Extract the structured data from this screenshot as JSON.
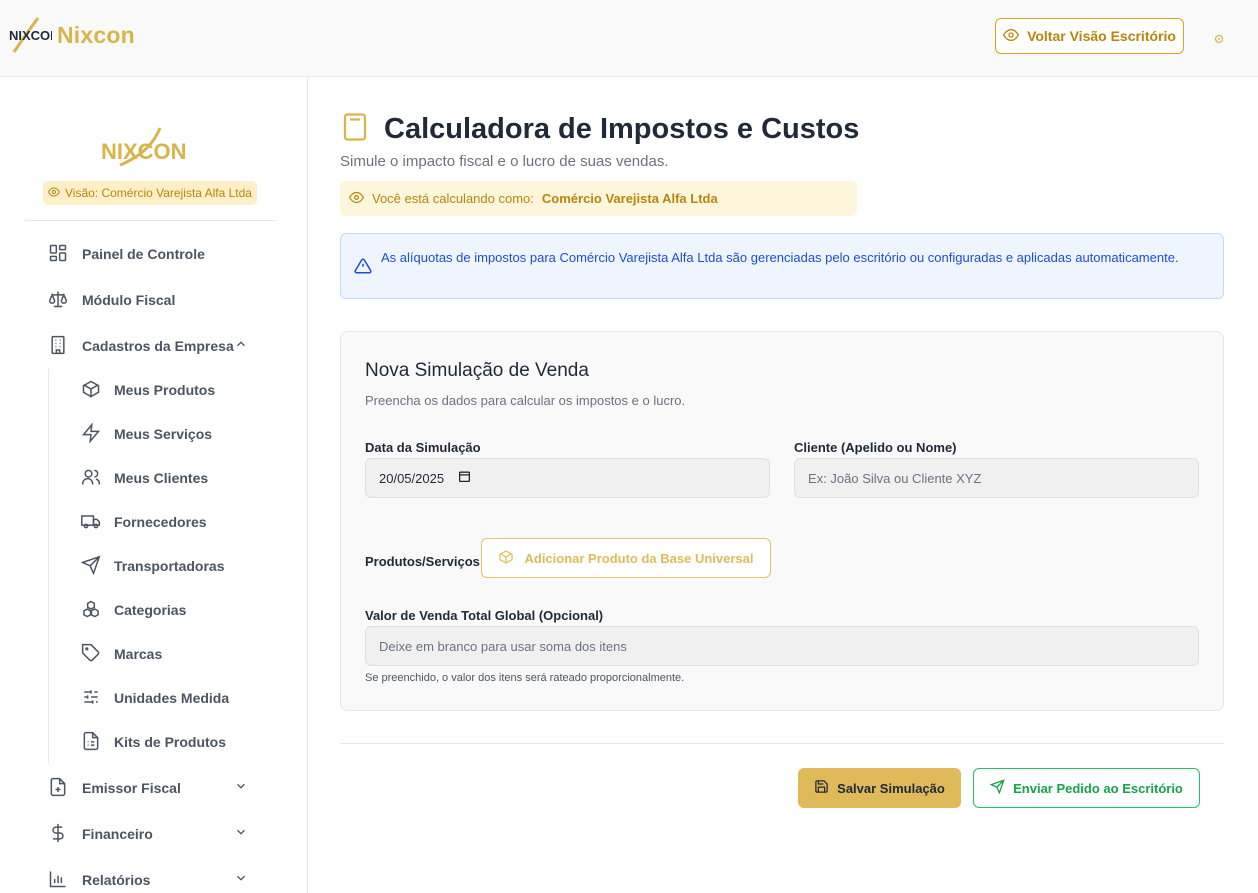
{
  "header": {
    "brand_name": "Nixcon",
    "logo_text": "NIXCON",
    "voltar_label": "Voltar Visão Escritório"
  },
  "sidebar": {
    "logo_text": "NIXCON",
    "visao_badge": "Visão: Comércio Varejista Alfa Ltda",
    "items": [
      {
        "label": "Painel de Controle",
        "icon": "dashboard-icon"
      },
      {
        "label": "Módulo Fiscal",
        "icon": "scale-icon"
      },
      {
        "label": "Cadastros da Empresa",
        "icon": "building-icon",
        "expanded": true
      },
      {
        "label": "Emissor Fiscal",
        "icon": "file-plus-icon"
      },
      {
        "label": "Financeiro",
        "icon": "dollar-icon"
      },
      {
        "label": "Relatórios",
        "icon": "bar-chart-icon"
      }
    ],
    "subitems": [
      {
        "label": "Meus Produtos",
        "icon": "box-icon"
      },
      {
        "label": "Meus Serviços",
        "icon": "zap-icon"
      },
      {
        "label": "Meus Clientes",
        "icon": "users-icon"
      },
      {
        "label": "Fornecedores",
        "icon": "truck-icon"
      },
      {
        "label": "Transportadoras",
        "icon": "send-icon"
      },
      {
        "label": "Categorias",
        "icon": "boxes-icon"
      },
      {
        "label": "Marcas",
        "icon": "tag-icon"
      },
      {
        "label": "Unidades Medida",
        "icon": "sliders-icon"
      },
      {
        "label": "Kits de Produtos",
        "icon": "kit-icon"
      }
    ]
  },
  "main": {
    "title": "Calculadora de Impostos e Custos",
    "subtitle": "Simule o impacto fiscal e o lucro de suas vendas.",
    "calc_as_prefix": "Você está calculando como:",
    "calc_as_company": "Comércio Varejista Alfa Ltda",
    "info_text": "As alíquotas de impostos para Comércio Varejista Alfa Ltda são gerenciadas pelo escritório ou configuradas e aplicadas automaticamente.",
    "card": {
      "title": "Nova Simulação de Venda",
      "description": "Preencha os dados para calcular os impostos e o lucro.",
      "date_label": "Data da Simulação",
      "date_value": "20/05/2025",
      "client_label": "Cliente (Apelido ou Nome)",
      "client_placeholder": "Ex: João Silva ou Cliente XYZ",
      "products_label": "Produtos/Serviços",
      "add_product_label": "Adicionar Produto da Base Universal",
      "total_label": "Valor de Venda Total Global (Opcional)",
      "total_placeholder": "Deixe em branco para usar soma dos itens",
      "total_hint": "Se preenchido, o valor dos itens será rateado proporcionalmente."
    },
    "save_label": "Salvar Simulação",
    "send_label": "Enviar Pedido ao Escritório"
  },
  "colors": {
    "accent": "#d9b44a",
    "info_blue": "#1d4ed8",
    "green": "#16a34a"
  }
}
